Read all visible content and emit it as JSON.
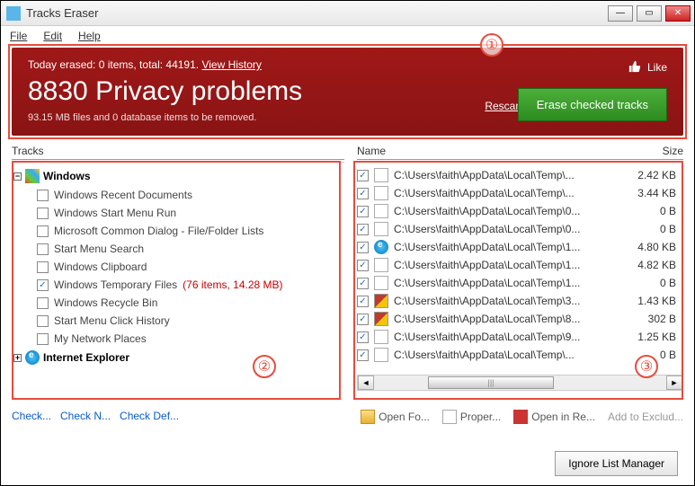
{
  "window": {
    "title": "Tracks Eraser"
  },
  "menu": {
    "file": "File",
    "edit": "Edit",
    "help": "Help"
  },
  "banner": {
    "summary_prefix": "Today erased: 0 items, total: 44191. ",
    "view_history": "View History",
    "headline": "8830 Privacy problems",
    "subline": "93.15 MB files and 0 database items to be removed.",
    "like": "Like",
    "rescan": "Rescan",
    "erase": "Erase checked tracks"
  },
  "left": {
    "header": "Tracks",
    "groups": {
      "windows": {
        "label": "Windows"
      },
      "ie": {
        "label": "Internet Explorer"
      }
    },
    "items": [
      {
        "label": "Windows Recent Documents",
        "checked": false
      },
      {
        "label": "Windows Start Menu Run",
        "checked": false
      },
      {
        "label": "Microsoft Common Dialog - File/Folder Lists",
        "checked": false
      },
      {
        "label": "Start Menu Search",
        "checked": false
      },
      {
        "label": "Windows Clipboard",
        "checked": false
      },
      {
        "label": "Windows Temporary Files",
        "extra": "(76 items, 14.28 MB)",
        "checked": true
      },
      {
        "label": "Windows Recycle Bin",
        "checked": false
      },
      {
        "label": "Start Menu Click History",
        "checked": false
      },
      {
        "label": "My Network Places",
        "checked": false
      }
    ],
    "checks": {
      "check": "Check...",
      "check_n": "Check N...",
      "check_def": "Check Def..."
    }
  },
  "right": {
    "col_name": "Name",
    "col_size": "Size",
    "files": [
      {
        "path": "C:\\Users\\faith\\AppData\\Local\\Temp\\...",
        "size": "2.42 KB",
        "icon": "file"
      },
      {
        "path": "C:\\Users\\faith\\AppData\\Local\\Temp\\...",
        "size": "3.44 KB",
        "icon": "file"
      },
      {
        "path": "C:\\Users\\faith\\AppData\\Local\\Temp\\0...",
        "size": "0 B",
        "icon": "file"
      },
      {
        "path": "C:\\Users\\faith\\AppData\\Local\\Temp\\0...",
        "size": "0 B",
        "icon": "file"
      },
      {
        "path": "C:\\Users\\faith\\AppData\\Local\\Temp\\1...",
        "size": "4.80 KB",
        "icon": "ie"
      },
      {
        "path": "C:\\Users\\faith\\AppData\\Local\\Temp\\1...",
        "size": "4.82 KB",
        "icon": "file"
      },
      {
        "path": "C:\\Users\\faith\\AppData\\Local\\Temp\\1...",
        "size": "0 B",
        "icon": "file"
      },
      {
        "path": "C:\\Users\\faith\\AppData\\Local\\Temp\\3...",
        "size": "1.43 KB",
        "icon": "pic"
      },
      {
        "path": "C:\\Users\\faith\\AppData\\Local\\Temp\\8...",
        "size": "302 B",
        "icon": "pic"
      },
      {
        "path": "C:\\Users\\faith\\AppData\\Local\\Temp\\9...",
        "size": "1.25 KB",
        "icon": "file"
      },
      {
        "path": "C:\\Users\\faith\\AppData\\Local\\Temp\\...",
        "size": "0 B",
        "icon": "file"
      }
    ],
    "actions": {
      "open_folder": "Open Fo...",
      "properties": "Proper...",
      "open_in_re": "Open in Re...",
      "add_exclude": "Add to Exclud..."
    }
  },
  "footer": {
    "ignore_list": "Ignore List Manager"
  },
  "annotations": {
    "a1": "①",
    "a2": "②",
    "a3": "③"
  }
}
